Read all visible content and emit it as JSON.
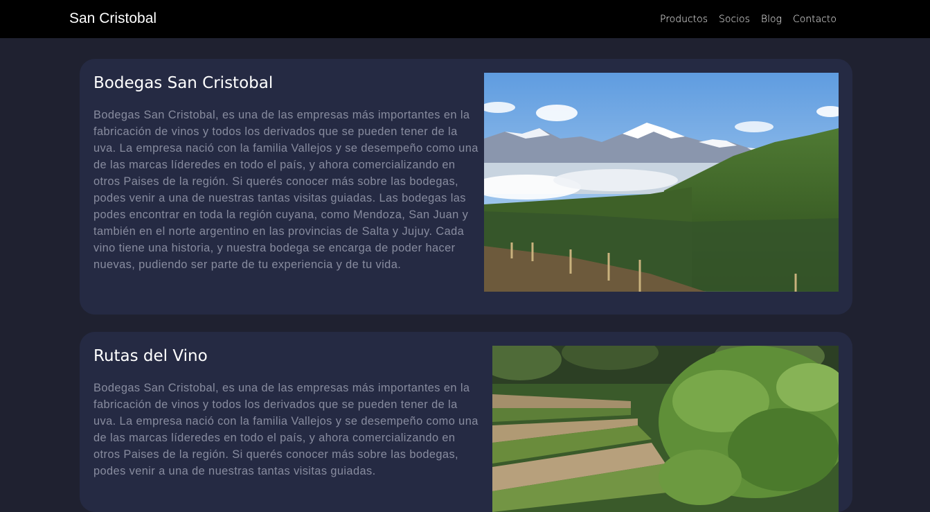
{
  "navbar": {
    "brand": "San Cristobal",
    "links": [
      "Productos",
      "Socios",
      "Blog",
      "Contacto"
    ]
  },
  "cards": [
    {
      "title": "Bodegas San Cristobal",
      "text": "Bodegas San Cristobal, es una de las empresas más importantes en la fabricación de vinos y todos los derivados que se pueden tener de la uva. La empresa nació con la familia Vallejos y se desempeño como una de las marcas líderedes en todo el país, y ahora comercializando en otros Paises de la región. Si querés conocer más sobre las bodegas, podes venir a una de nuestras tantas visitas guiadas. Las bodegas las podes encontrar en toda la región cuyana, como Mendoza, San Juan y también en el norte argentino en las provincias de Salta y Jujuy. Cada vino tiene una historia, y nuestra bodega se encarga de poder hacer nuevas, pudiendo ser parte de tu experiencia y de tu vida.",
      "image": "vineyard-mountains-photo"
    },
    {
      "title": "Rutas del Vino",
      "text": "Bodegas San Cristobal, es una de las empresas más importantes en la fabricación de vinos y todos los derivados que se pueden tener de la uva. La empresa nació con la familia Vallejos y se desempeño como una de las marcas líderedes en todo el país, y ahora comercializando en otros Paises de la región. Si querés conocer más sobre las bodegas, podes venir a una de nuestras tantas visitas guiadas.",
      "image": "vineyard-rows-photo"
    }
  ],
  "colors": {
    "navbar": "#000000",
    "page_background": "#1f2130",
    "card_background": "#252a43",
    "card_text": "#888c9f"
  }
}
